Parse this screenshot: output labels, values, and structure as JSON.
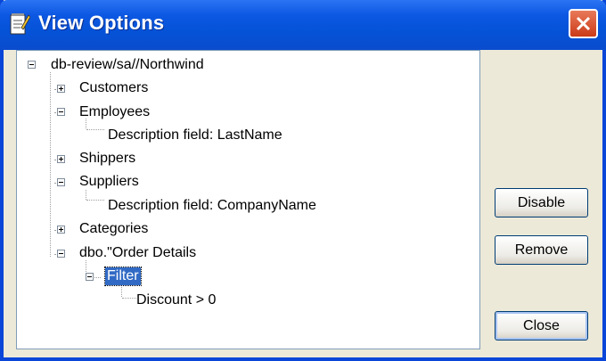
{
  "window": {
    "title": "View Options"
  },
  "tree": {
    "root": "db-review/sa//Northwind",
    "items": [
      {
        "label": "Customers",
        "state": "collapsed"
      },
      {
        "label": "Employees",
        "state": "expanded"
      },
      {
        "label": "Description field: LastName",
        "state": "leaf"
      },
      {
        "label": "Shippers",
        "state": "collapsed"
      },
      {
        "label": "Suppliers",
        "state": "expanded"
      },
      {
        "label": "Description field: CompanyName",
        "state": "leaf"
      },
      {
        "label": "Categories",
        "state": "collapsed"
      },
      {
        "label": "dbo.\"Order Details",
        "state": "expanded"
      },
      {
        "label": "Filter",
        "state": "expanded",
        "selected": true
      },
      {
        "label": "Discount > 0",
        "state": "leaf"
      }
    ]
  },
  "buttons": {
    "disable": "Disable",
    "remove": "Remove",
    "close": "Close"
  },
  "colors": {
    "titlebar": "#0553d8",
    "selection": "#316ac5",
    "window_bg": "#ece9d8"
  }
}
